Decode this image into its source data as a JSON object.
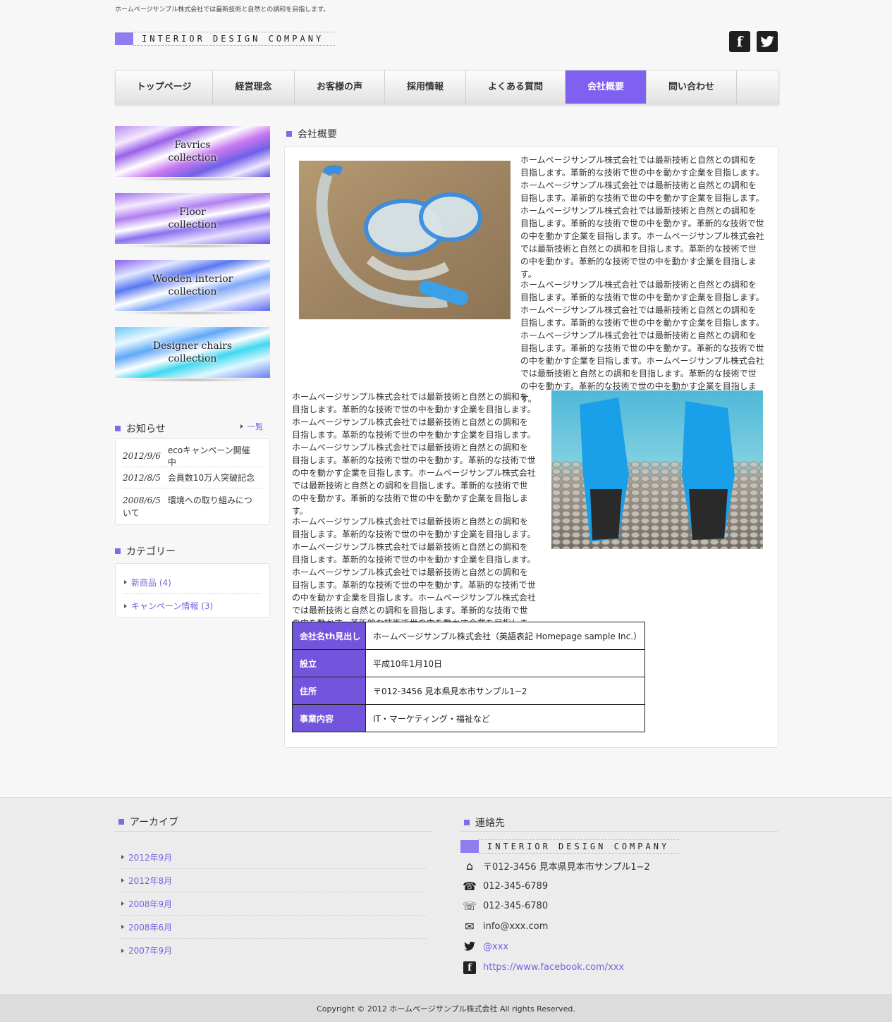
{
  "header": {
    "tagline": "ホームページサンプル株式会社では最新技術と自然との調和を目指します。",
    "logo_text": "INTERIOR DESIGN COMPANY",
    "facebook_glyph": "f",
    "twitter_glyph": "🐦"
  },
  "nav": {
    "items": [
      "トップページ",
      "経営理念",
      "お客様の声",
      "採用情報",
      "よくある質問",
      "会社概要",
      "問い合わせ"
    ],
    "active_index": 5
  },
  "banners": [
    {
      "line1": "Favrics",
      "line2": "collection"
    },
    {
      "line1": "Floor",
      "line2": "collection"
    },
    {
      "line1": "Wooden interior",
      "line2": "collection"
    },
    {
      "line1": "Designer chairs",
      "line2": "collection"
    }
  ],
  "news": {
    "heading": "お知らせ",
    "list_link": "一覧",
    "items": [
      {
        "date": "2012/9/6",
        "text": "ecoキャンペーン開催中"
      },
      {
        "date": "2012/8/5",
        "text": "会員数10万人突破記念"
      },
      {
        "date": "2008/6/5",
        "text": "環境への取り組みについて"
      }
    ]
  },
  "categories": {
    "heading": "カテゴリー",
    "items": [
      "新商品 (4)",
      "キャンペーン情報 (3)"
    ]
  },
  "main": {
    "heading": "会社概要",
    "para1a": "ホームページサンプル株式会社では最新技術と自然との調和を目指します。革新的な技術で世の中を動かす企業を目指します。ホームページサンプル株式会社では最新技術と自然との調和を目指します。革新的な技術で世の中を動かす企業を目指します。ホームページサンプル株式会社では最新技術と自然との調和を目指します。革新的な技術で世の中を動かす。革新的な技術で世の中を動かす企業を目指します。ホームページサンプル株式会社では最新技術と自然との調和を目指します。革新的な技術で世の中を動かす。革新的な技術で世の中を動かす企業を目指します。",
    "para1b": "ホームページサンプル株式会社では最新技術と自然との調和を目指します。革新的な技術で世の中を動かす企業を目指します。ホームページサンプル株式会社では最新技術と自然との調和を目指します。革新的な技術で世の中を動かす企業を目指します。ホームページサンプル株式会社では最新技術と自然との調和を目指します。革新的な技術で世の中を動かす。革新的な技術で世の中を動かす企業を目指します。ホームページサンプル株式会社では最新技術と自然との調和を目指します。革新的な技術で世の中を動かす。革新的な技術で世の中を動かす企業を目指します。",
    "para2a": "ホームページサンプル株式会社では最新技術と自然との調和を目指します。革新的な技術で世の中を動かす企業を目指します。ホームページサンプル株式会社では最新技術と自然との調和を目指します。革新的な技術で世の中を動かす企業を目指します。ホームページサンプル株式会社では最新技術と自然との調和を目指します。革新的な技術で世の中を動かす。革新的な技術で世の中を動かす企業を目指します。ホームページサンプル株式会社では最新技術と自然との調和を目指します。革新的な技術で世の中を動かす。革新的な技術で世の中を動かす企業を目指します。",
    "para2b": "ホームページサンプル株式会社では最新技術と自然との調和を目指します。革新的な技術で世の中を動かす企業を目指します。ホームページサンプル株式会社では最新技術と自然との調和を目指します。革新的な技術で世の中を動かす企業を目指します。ホームページサンプル株式会社では最新技術と自然との調和を目指します。革新的な技術で世の中を動かす。革新的な技術で世の中を動かす企業を目指します。ホームページサンプル株式会社では最新技術と自然との調和を目指します。革新的な技術で世の中を動かす。革新的な技術で世の中を動かす企業を目指します。",
    "table": [
      {
        "th": "会社名th見出し",
        "td": "ホームページサンプル株式会社（英語表記 Homepage sample Inc.）"
      },
      {
        "th": "設立",
        "td": "平成10年1月10日"
      },
      {
        "th": "住所",
        "td": "〒012-3456 見本県見本市サンプル1−2"
      },
      {
        "th": "事業内容",
        "td": "IT・マーケティング・福祉など"
      }
    ]
  },
  "footer": {
    "archive_heading": "アーカイブ",
    "archives": [
      "2012年9月",
      "2012年8月",
      "2008年9月",
      "2008年6月",
      "2007年9月"
    ],
    "contact_heading": "連絡先",
    "contact_logo": "INTERIOR DESIGN COMPANY",
    "address": "〒012-3456 見本県見本市サンプル1−2",
    "tel": "012-345-6789",
    "fax": "012-345-6780",
    "email": "info@xxx.com",
    "twitter": "@xxx",
    "facebook": "https://www.facebook.com/xxx",
    "copyright": "Copyright © 2012 ホームページサンプル株式会社 All rights Reserved."
  },
  "colors": {
    "accent": "#7b6ce8",
    "nav_active": "#8060f0",
    "table_header": "#7355dd",
    "link": "#7763e0"
  }
}
